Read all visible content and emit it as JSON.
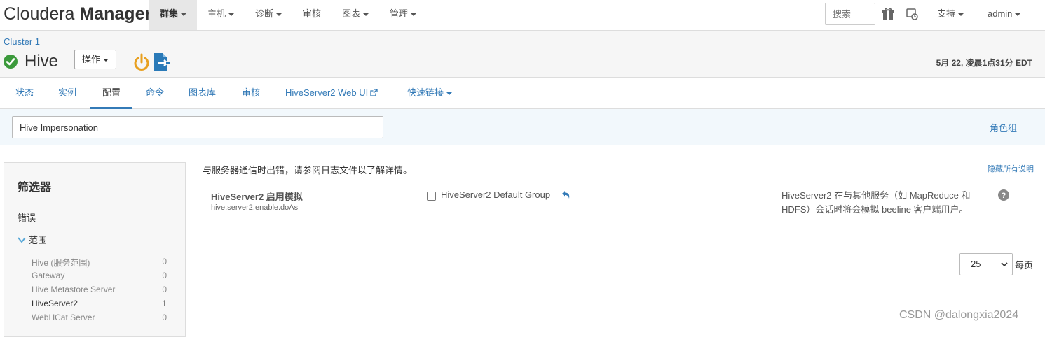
{
  "brand": {
    "light": "Cloudera ",
    "bold": "Manager"
  },
  "topnav": {
    "items": [
      {
        "label": "群集",
        "active": true,
        "dropdown": true
      },
      {
        "label": "主机",
        "dropdown": true
      },
      {
        "label": "诊断",
        "dropdown": true
      },
      {
        "label": "审核",
        "dropdown": false
      },
      {
        "label": "图表",
        "dropdown": true
      },
      {
        "label": "管理",
        "dropdown": true
      }
    ],
    "search_placeholder": "搜索",
    "support": "支持",
    "user": "admin",
    "icons": [
      "parcel-icon",
      "running-commands-icon"
    ]
  },
  "header": {
    "breadcrumb": "Cluster 1",
    "service_name": "Hive",
    "actions_label": "操作",
    "timestamp": "5月 22, 凌晨1点31分 EDT",
    "status": "good"
  },
  "tabs": [
    {
      "label": "状态"
    },
    {
      "label": "实例"
    },
    {
      "label": "配置",
      "active": true
    },
    {
      "label": "命令"
    },
    {
      "label": "图表库"
    },
    {
      "label": "审核"
    },
    {
      "label": "HiveServer2 Web UI",
      "external": true
    },
    {
      "label": "快速链接",
      "dropdown": true
    }
  ],
  "search": {
    "value": "Hive Impersonation"
  },
  "role_groups_link": "角色组",
  "filter": {
    "title": "筛选器",
    "errors": "错误",
    "scope": "范围",
    "items": [
      {
        "label": "Hive (服务范围)",
        "count": "0"
      },
      {
        "label": "Gateway",
        "count": "0"
      },
      {
        "label": "Hive Metastore Server",
        "count": "0"
      },
      {
        "label": "HiveServer2",
        "count": "1",
        "selected": true
      },
      {
        "label": "WebHCat Server",
        "count": "0"
      }
    ]
  },
  "main": {
    "error_message": "与服务器通信时出错，请参阅日志文件以了解详情。",
    "hide_descriptions": "隐藏所有说明",
    "property": {
      "name": "HiveServer2 启用模拟",
      "key": "hive.server2.enable.doAs",
      "group_label": "HiveServer2 Default Group",
      "checked": false,
      "description": "HiveServer2 在与其他服务（如 MapReduce 和 HDFS）会话时将会模拟 beeline 客户端用户。"
    },
    "per_page_value": "25",
    "per_page_label": "每页"
  },
  "watermark": "CSDN @dalongxia2024",
  "colors": {
    "link": "#337ab7",
    "ok_green": "#3c9a3c",
    "power_orange": "#e8a020",
    "export_blue": "#2a7ab8"
  }
}
